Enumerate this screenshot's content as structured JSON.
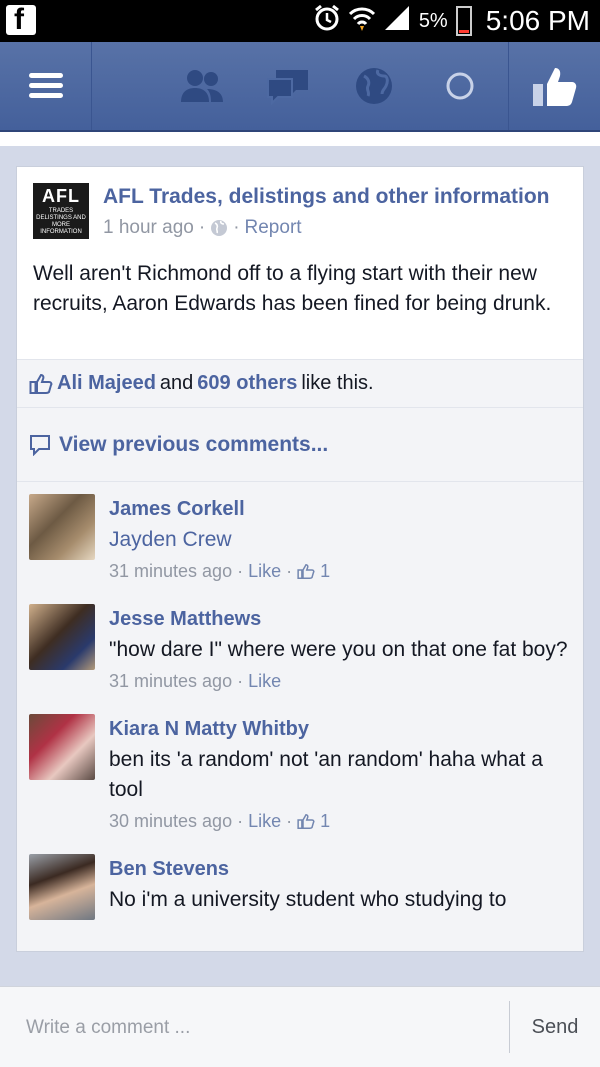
{
  "statusbar": {
    "battery_pct": "5%",
    "time": "5:06 PM",
    "fb_letter": "f"
  },
  "navbar": {
    "icons": [
      "menu-icon",
      "friends-icon",
      "messages-icon",
      "notifications-globe-icon",
      "loading-icon",
      "like-icon"
    ]
  },
  "post": {
    "logo": {
      "big": "AFL",
      "small": "TRADES DELISTINGS AND MORE INFORMATION"
    },
    "page_name": "AFL Trades, delistings and other information",
    "time": "1 hour ago",
    "separator": "·",
    "report": "Report",
    "text": "Well aren't Richmond off to a flying start with their new recruits, Aaron Edwards has been fined for being drunk."
  },
  "likes": {
    "first": "Ali Majeed",
    "and": "and",
    "others": "609 others",
    "suffix": "like this."
  },
  "view_previous": "View previous comments...",
  "comments": [
    {
      "name": "James Corkell",
      "text": "Jayden Crew",
      "time": "31 minutes ago",
      "like": "Like",
      "like_count": "1"
    },
    {
      "name": "Jesse Matthews",
      "text": "\"how dare I\" where were you on that one fat boy?",
      "time": "31 minutes ago",
      "like": "Like"
    },
    {
      "name": "Kiara N Matty Whitby",
      "text": "ben its 'a random' not 'an random' haha what a tool",
      "time": "30 minutes ago",
      "like": "Like",
      "like_count": "1"
    },
    {
      "name": "Ben Stevens",
      "text": "No i'm a university student who studying to"
    }
  ],
  "composer": {
    "placeholder": "Write a comment ...",
    "send": "Send"
  },
  "colors": {
    "fb_blue": "#4c64a0",
    "navbar": "#4d69a2",
    "text": "#141823",
    "meta": "#9197a3"
  }
}
